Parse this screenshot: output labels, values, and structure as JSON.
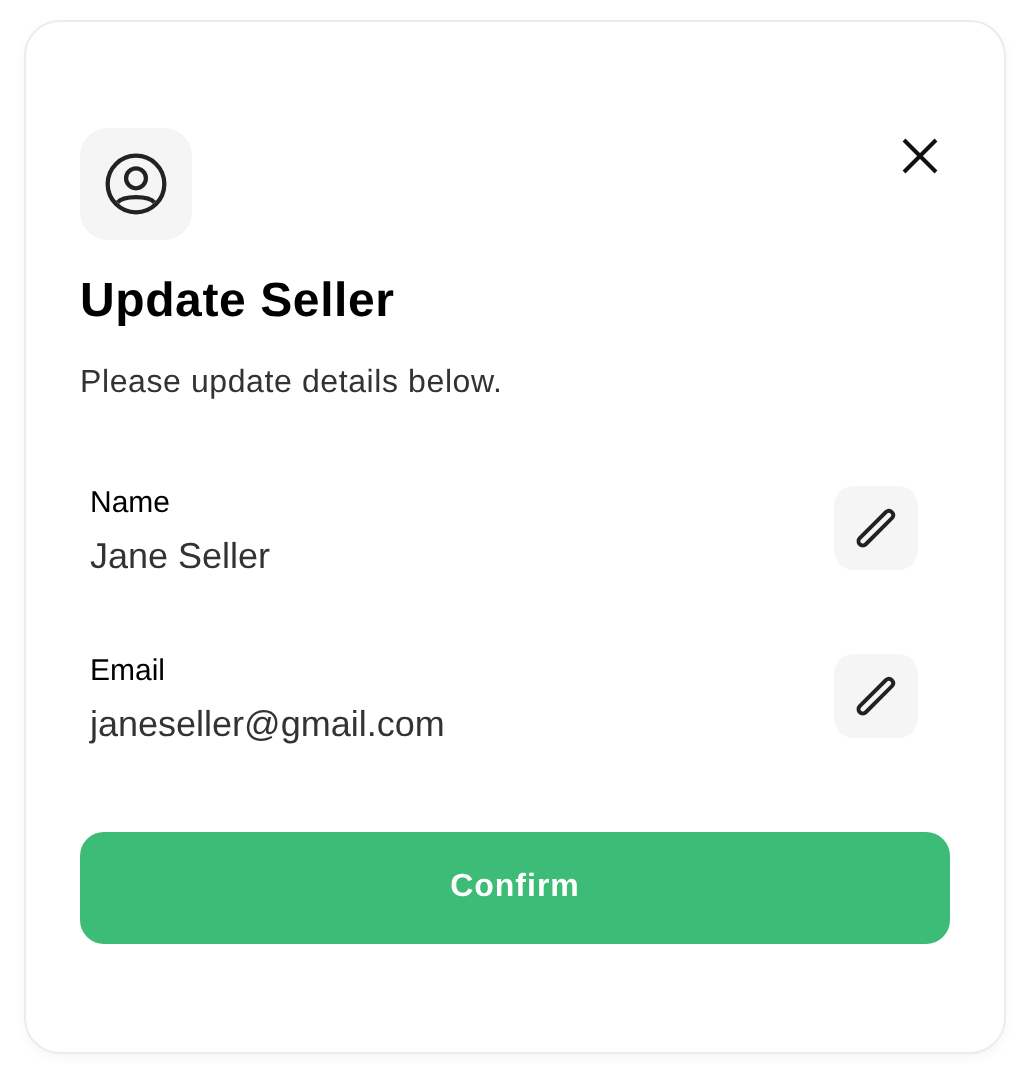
{
  "dialog": {
    "title": "Update Seller",
    "subtitle": "Please update details below.",
    "fields": [
      {
        "label": "Name",
        "value": "Jane Seller"
      },
      {
        "label": "Email",
        "value": "janeseller@gmail.com"
      }
    ],
    "confirm": "Confirm"
  }
}
